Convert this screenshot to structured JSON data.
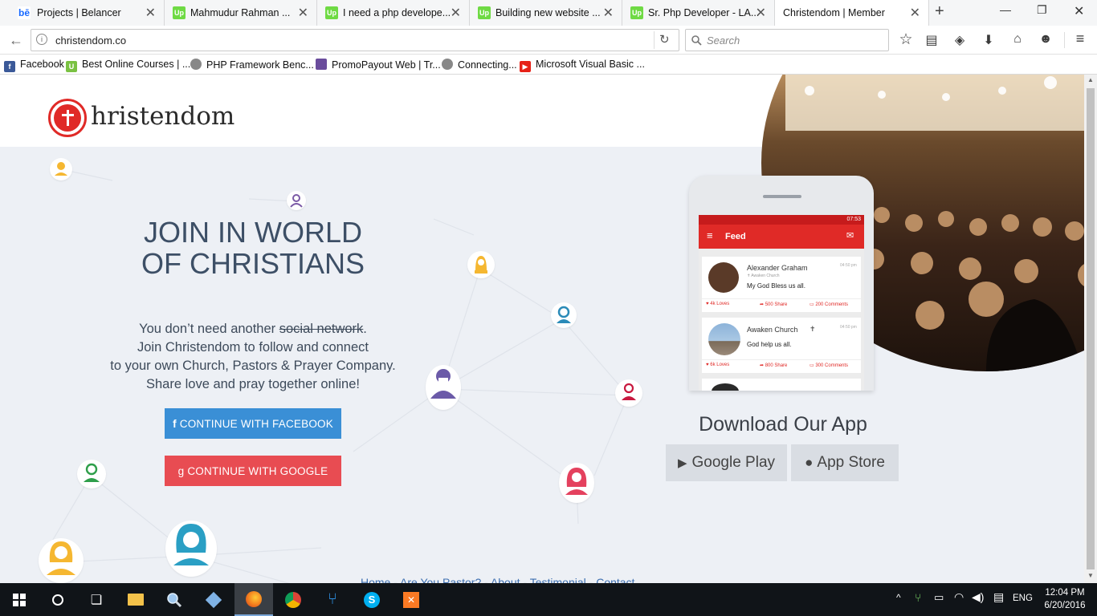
{
  "browser": {
    "tabs": [
      {
        "title": "Projects | Belancer",
        "icon": "behance-icon",
        "color": "#1769ff"
      },
      {
        "title": "Mahmudur Rahman ...",
        "icon": "upwork-icon",
        "color": "#6fda44"
      },
      {
        "title": "I need a php develope...",
        "icon": "upwork-icon",
        "color": "#6fda44"
      },
      {
        "title": "Building new website ...",
        "icon": "upwork-icon",
        "color": "#6fda44"
      },
      {
        "title": "Sr. Php Developer - LA...",
        "icon": "upwork-icon",
        "color": "#6fda44"
      },
      {
        "title": "Christendom | Member",
        "icon": "none",
        "color": "#ffffff"
      }
    ],
    "url": "christendom.co",
    "search_placeholder": "Search",
    "bookmarks": [
      {
        "label": "Facebook",
        "icon": "facebook-icon",
        "color": "#3b5998"
      },
      {
        "label": "Best Online Courses | ...",
        "icon": "udemy-icon",
        "color": "#7ac142"
      },
      {
        "label": "PHP Framework Benc...",
        "icon": "globe-icon",
        "color": "#888888"
      },
      {
        "label": "PromoPayout Web | Tr...",
        "icon": "doc-icon",
        "color": "#6a4c9c"
      },
      {
        "label": "Connecting...",
        "icon": "globe-icon",
        "color": "#888888"
      },
      {
        "label": "Microsoft Visual Basic ...",
        "icon": "youtube-icon",
        "color": "#e62117"
      }
    ]
  },
  "site": {
    "logo_text": "hristendom",
    "hero_title_line1": "JOIN IN WORLD",
    "hero_title_line2": "OF CHRISTIANS",
    "hero_line1_before": "You don’t need another ",
    "hero_line1_strike": "social network",
    "hero_line1_after": ".",
    "hero_line2": "Join Christendom to follow and connect",
    "hero_line3": "to your own Church, Pastors & Prayer Company.",
    "hero_line4": "Share love and pray together online!",
    "facebook_button": "CONTINUE WITH FACEBOOK",
    "google_button": "CONTINUE WITH GOOGLE",
    "download_title": "Download Our App",
    "google_play": "Google Play",
    "app_store": "App Store",
    "footer_links": [
      "Home",
      "Are You Pastor?",
      "About",
      "Testimonial",
      "Contact"
    ],
    "colors": {
      "facebook": "#3a8fd6",
      "google": "#e84c52",
      "brand_red": "#e02a27"
    }
  },
  "phone": {
    "status_time": "07:53",
    "feed_title": "Feed",
    "posts": [
      {
        "author": "Alexander Graham",
        "sub": "✝ Awaken Church",
        "time": "04:50 pm",
        "text": "My God Bless us all.",
        "loves": "4k Loves",
        "shares": "500 Share",
        "comments": "200 Comments"
      },
      {
        "author": "Awaken Church",
        "sub": "",
        "time": "04:50 pm",
        "text": "God help us all.",
        "loves": "6k Loves",
        "shares": "800 Share",
        "comments": "300 Comments"
      }
    ]
  },
  "taskbar": {
    "language": "ENG",
    "time": "12:04 PM",
    "date": "6/20/2016"
  }
}
